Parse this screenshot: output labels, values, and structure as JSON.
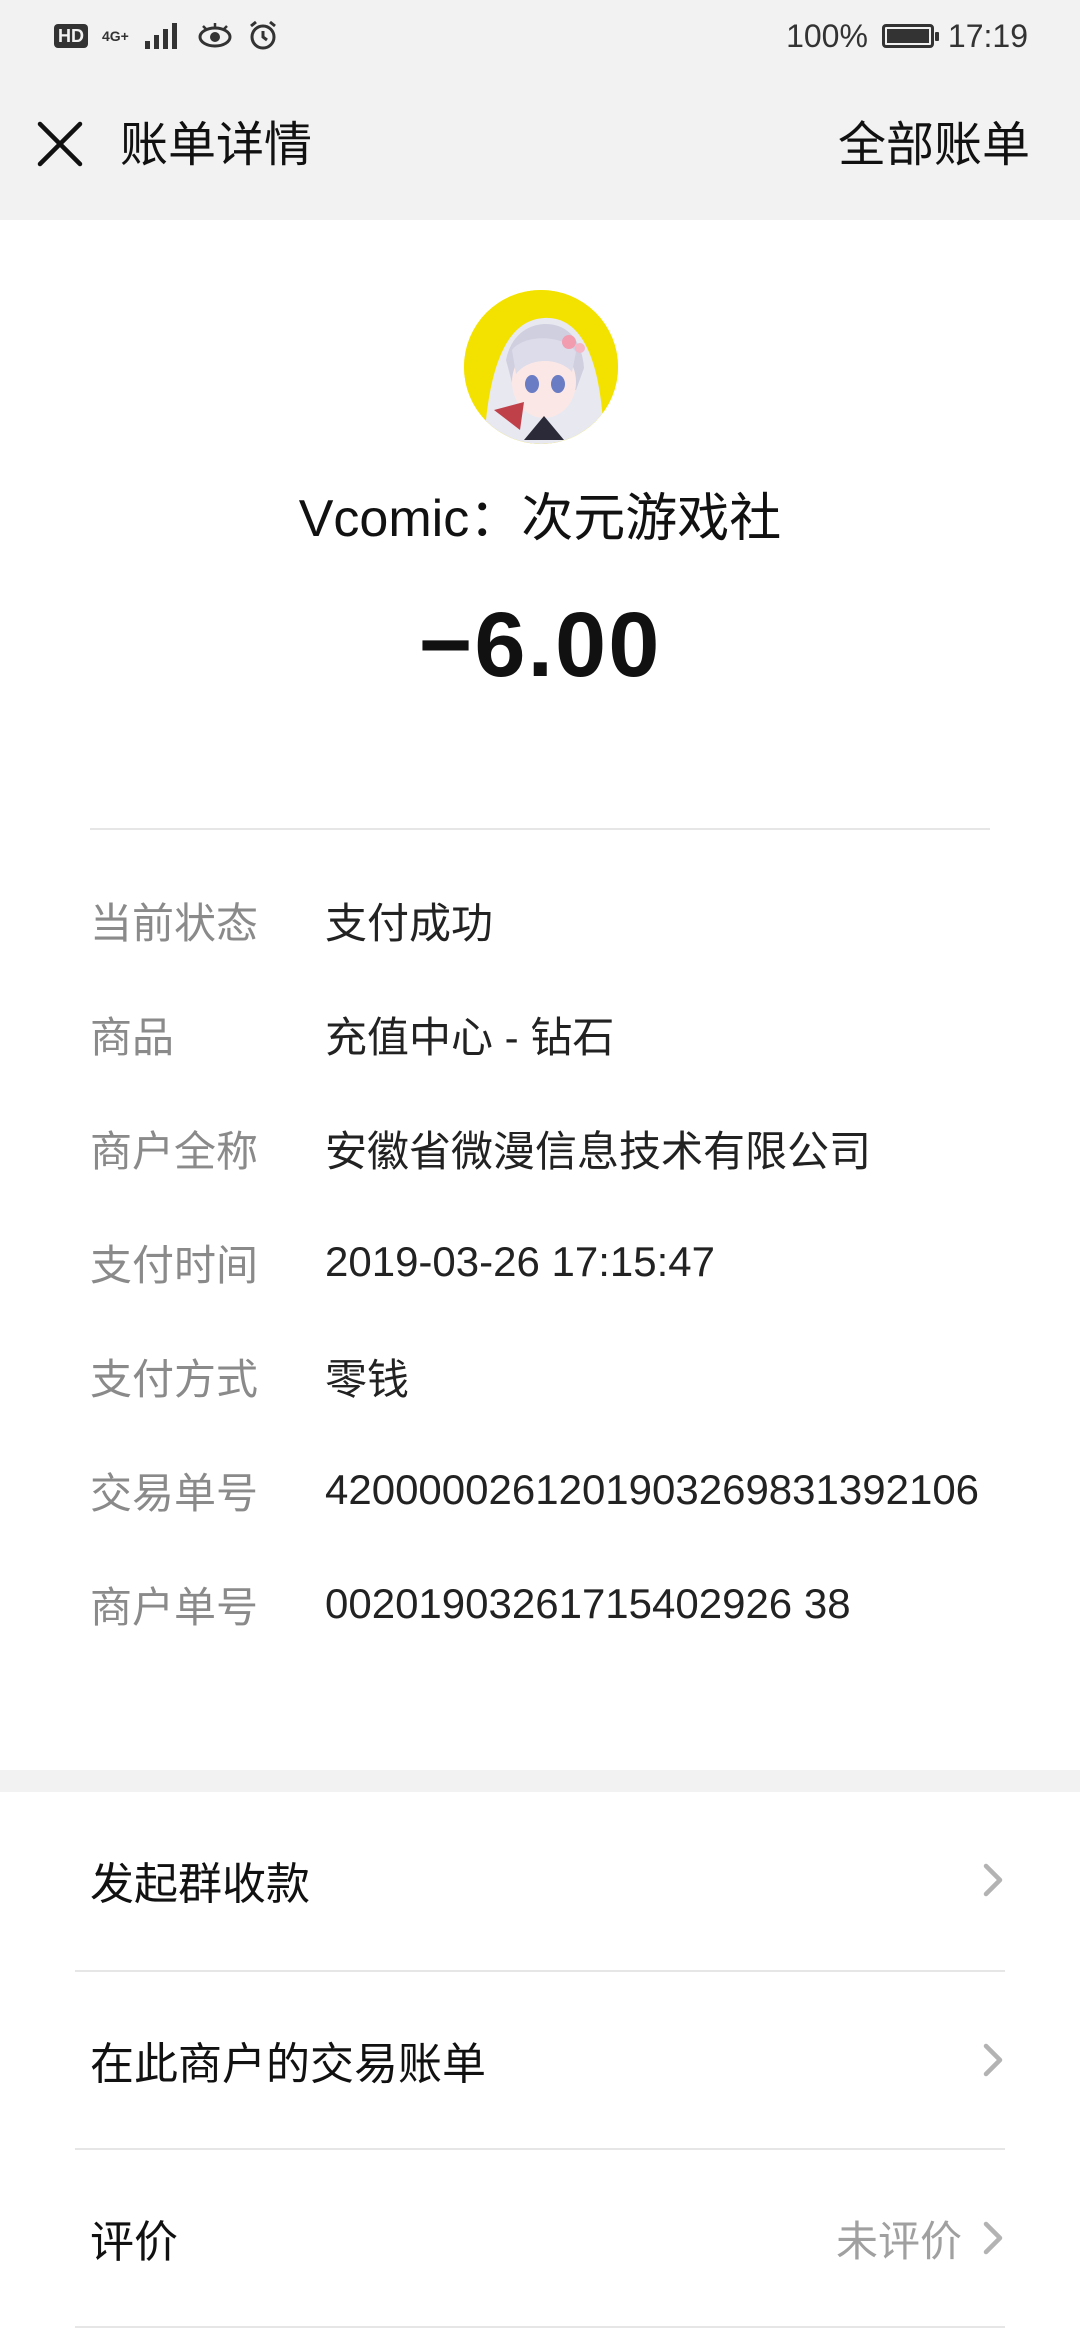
{
  "status_bar": {
    "hd": "HD",
    "network": "4G+",
    "battery_percent": "100%",
    "time": "17:19"
  },
  "header": {
    "title": "账单详情",
    "action": "全部账单"
  },
  "merchant": {
    "name": "Vcomic：次元游戏社",
    "amount": "−6.00"
  },
  "details": [
    {
      "label": "当前状态",
      "value": "支付成功"
    },
    {
      "label": "商品",
      "value": "充值中心 - 钻石"
    },
    {
      "label": "商户全称",
      "value": "安徽省微漫信息技术有限公司"
    },
    {
      "label": "支付时间",
      "value": "2019-03-26 17:15:47"
    },
    {
      "label": "支付方式",
      "value": "零钱"
    },
    {
      "label": "交易单号",
      "value": "4200000261201903269831392106"
    },
    {
      "label": "商户单号",
      "value": "00201903261715402926 38"
    }
  ],
  "actions": [
    {
      "label": "发起群收款",
      "right_text": ""
    },
    {
      "label": "在此商户的交易账单",
      "right_text": ""
    },
    {
      "label": "评价",
      "right_text": "未评价"
    }
  ],
  "icons": {
    "close": "close-icon",
    "chevron": "chevron-right-icon",
    "eye": "eye-icon",
    "alarm": "alarm-icon",
    "signal": "signal-icon",
    "battery": "battery-icon"
  }
}
